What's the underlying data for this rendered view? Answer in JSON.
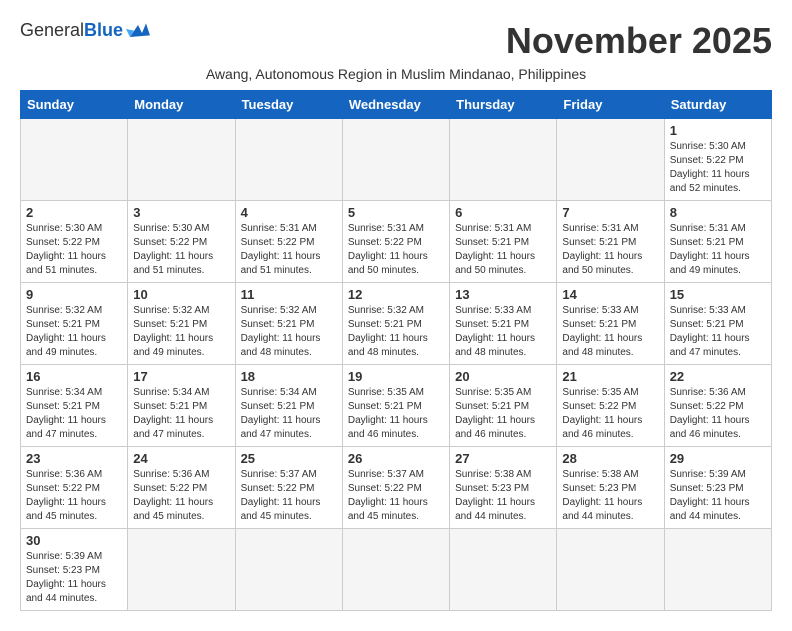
{
  "header": {
    "logo_general": "General",
    "logo_blue": "Blue",
    "month_title": "November 2025",
    "subtitle": "Awang, Autonomous Region in Muslim Mindanao, Philippines"
  },
  "weekdays": [
    "Sunday",
    "Monday",
    "Tuesday",
    "Wednesday",
    "Thursday",
    "Friday",
    "Saturday"
  ],
  "weeks": [
    [
      {
        "day": "",
        "empty": true
      },
      {
        "day": "",
        "empty": true
      },
      {
        "day": "",
        "empty": true
      },
      {
        "day": "",
        "empty": true
      },
      {
        "day": "",
        "empty": true
      },
      {
        "day": "",
        "empty": true
      },
      {
        "day": "1",
        "sunrise": "5:30 AM",
        "sunset": "5:22 PM",
        "daylight": "11 hours and 52 minutes."
      }
    ],
    [
      {
        "day": "2",
        "sunrise": "5:30 AM",
        "sunset": "5:22 PM",
        "daylight": "11 hours and 51 minutes."
      },
      {
        "day": "3",
        "sunrise": "5:30 AM",
        "sunset": "5:22 PM",
        "daylight": "11 hours and 51 minutes."
      },
      {
        "day": "4",
        "sunrise": "5:31 AM",
        "sunset": "5:22 PM",
        "daylight": "11 hours and 51 minutes."
      },
      {
        "day": "5",
        "sunrise": "5:31 AM",
        "sunset": "5:22 PM",
        "daylight": "11 hours and 50 minutes."
      },
      {
        "day": "6",
        "sunrise": "5:31 AM",
        "sunset": "5:21 PM",
        "daylight": "11 hours and 50 minutes."
      },
      {
        "day": "7",
        "sunrise": "5:31 AM",
        "sunset": "5:21 PM",
        "daylight": "11 hours and 50 minutes."
      },
      {
        "day": "8",
        "sunrise": "5:31 AM",
        "sunset": "5:21 PM",
        "daylight": "11 hours and 49 minutes."
      }
    ],
    [
      {
        "day": "9",
        "sunrise": "5:32 AM",
        "sunset": "5:21 PM",
        "daylight": "11 hours and 49 minutes."
      },
      {
        "day": "10",
        "sunrise": "5:32 AM",
        "sunset": "5:21 PM",
        "daylight": "11 hours and 49 minutes."
      },
      {
        "day": "11",
        "sunrise": "5:32 AM",
        "sunset": "5:21 PM",
        "daylight": "11 hours and 48 minutes."
      },
      {
        "day": "12",
        "sunrise": "5:32 AM",
        "sunset": "5:21 PM",
        "daylight": "11 hours and 48 minutes."
      },
      {
        "day": "13",
        "sunrise": "5:33 AM",
        "sunset": "5:21 PM",
        "daylight": "11 hours and 48 minutes."
      },
      {
        "day": "14",
        "sunrise": "5:33 AM",
        "sunset": "5:21 PM",
        "daylight": "11 hours and 48 minutes."
      },
      {
        "day": "15",
        "sunrise": "5:33 AM",
        "sunset": "5:21 PM",
        "daylight": "11 hours and 47 minutes."
      }
    ],
    [
      {
        "day": "16",
        "sunrise": "5:34 AM",
        "sunset": "5:21 PM",
        "daylight": "11 hours and 47 minutes."
      },
      {
        "day": "17",
        "sunrise": "5:34 AM",
        "sunset": "5:21 PM",
        "daylight": "11 hours and 47 minutes."
      },
      {
        "day": "18",
        "sunrise": "5:34 AM",
        "sunset": "5:21 PM",
        "daylight": "11 hours and 47 minutes."
      },
      {
        "day": "19",
        "sunrise": "5:35 AM",
        "sunset": "5:21 PM",
        "daylight": "11 hours and 46 minutes."
      },
      {
        "day": "20",
        "sunrise": "5:35 AM",
        "sunset": "5:21 PM",
        "daylight": "11 hours and 46 minutes."
      },
      {
        "day": "21",
        "sunrise": "5:35 AM",
        "sunset": "5:22 PM",
        "daylight": "11 hours and 46 minutes."
      },
      {
        "day": "22",
        "sunrise": "5:36 AM",
        "sunset": "5:22 PM",
        "daylight": "11 hours and 46 minutes."
      }
    ],
    [
      {
        "day": "23",
        "sunrise": "5:36 AM",
        "sunset": "5:22 PM",
        "daylight": "11 hours and 45 minutes."
      },
      {
        "day": "24",
        "sunrise": "5:36 AM",
        "sunset": "5:22 PM",
        "daylight": "11 hours and 45 minutes."
      },
      {
        "day": "25",
        "sunrise": "5:37 AM",
        "sunset": "5:22 PM",
        "daylight": "11 hours and 45 minutes."
      },
      {
        "day": "26",
        "sunrise": "5:37 AM",
        "sunset": "5:22 PM",
        "daylight": "11 hours and 45 minutes."
      },
      {
        "day": "27",
        "sunrise": "5:38 AM",
        "sunset": "5:23 PM",
        "daylight": "11 hours and 44 minutes."
      },
      {
        "day": "28",
        "sunrise": "5:38 AM",
        "sunset": "5:23 PM",
        "daylight": "11 hours and 44 minutes."
      },
      {
        "day": "29",
        "sunrise": "5:39 AM",
        "sunset": "5:23 PM",
        "daylight": "11 hours and 44 minutes."
      }
    ],
    [
      {
        "day": "30",
        "sunrise": "5:39 AM",
        "sunset": "5:23 PM",
        "daylight": "11 hours and 44 minutes."
      },
      {
        "day": "",
        "empty": true
      },
      {
        "day": "",
        "empty": true
      },
      {
        "day": "",
        "empty": true
      },
      {
        "day": "",
        "empty": true
      },
      {
        "day": "",
        "empty": true
      },
      {
        "day": "",
        "empty": true
      }
    ]
  ]
}
